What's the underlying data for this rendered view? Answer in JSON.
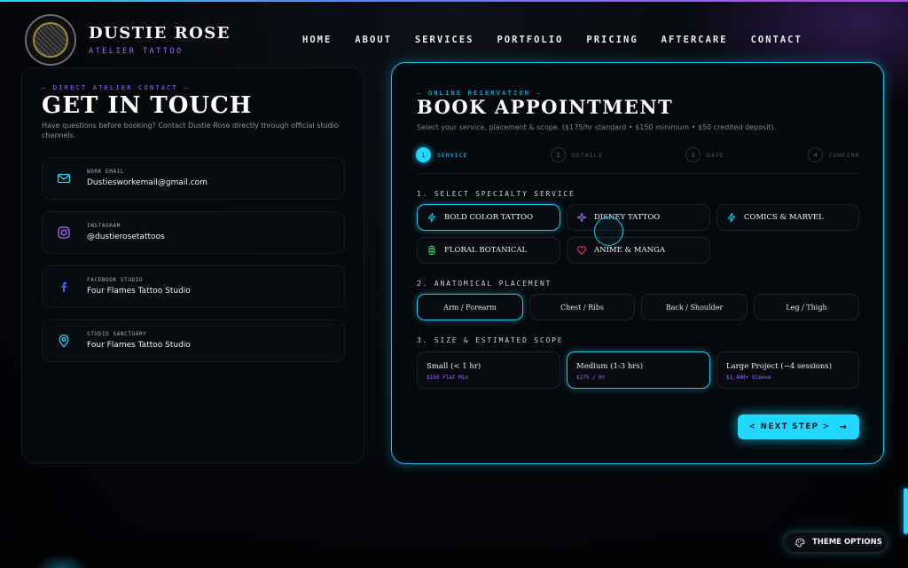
{
  "brand": {
    "name": "DUSTIE ROSE",
    "subtitle": "ATELIER TATTOO",
    "logo_text": "DUSTIE ROSE"
  },
  "nav": [
    "HOME",
    "ABOUT",
    "SERVICES",
    "PORTFOLIO",
    "PRICING",
    "AFTERCARE",
    "CONTACT"
  ],
  "contact": {
    "eyebrow": "— DIRECT ATELIER CONTACT —",
    "title": "GET IN TOUCH",
    "description": "Have questions before booking? Contact Dustie Rose directly through official studio channels.",
    "cards": [
      {
        "label": "WORK EMAIL",
        "value": "Dustiesworkemail@gmail.com",
        "icon": "mail-icon"
      },
      {
        "label": "INSTAGRAM",
        "value": "@dustierosetattoos",
        "icon": "instagram-icon"
      },
      {
        "label": "FACEBOOK STUDIO",
        "value": "Four Flames Tattoo Studio",
        "icon": "facebook-icon"
      },
      {
        "label": "STUDIO SANCTUARY",
        "value": "Four Flames Tattoo Studio",
        "icon": "map-pin-icon"
      }
    ]
  },
  "booking": {
    "eyebrow": "— ONLINE RESERVATION —",
    "title": "BOOK APPOINTMENT",
    "description": "Select your service, placement & scope. ($175/hr standard • $150 minimum • $50 credited deposit).",
    "steps": [
      {
        "num": "1",
        "label": "SERVICE",
        "active": true
      },
      {
        "num": "2",
        "label": "DETAILS",
        "active": false
      },
      {
        "num": "3",
        "label": "DATE",
        "active": false
      },
      {
        "num": "4",
        "label": "CONFIRM",
        "active": false
      }
    ],
    "section_service": "1. SELECT SPECIALTY SERVICE",
    "services": [
      {
        "label": "BOLD COLOR TATTOO",
        "icon": "lightning-icon",
        "selected": true
      },
      {
        "label": "DISNEY TATTOO",
        "icon": "sparkle-icon",
        "selected": false
      },
      {
        "label": "COMICS & MARVEL",
        "icon": "lightning-icon",
        "selected": false
      },
      {
        "label": "FLORAL BOTANICAL",
        "icon": "leaf-icon",
        "selected": false
      },
      {
        "label": "ANIME & MANGA",
        "icon": "heart-icon",
        "selected": false
      }
    ],
    "section_placement": "2. ANATOMICAL PLACEMENT",
    "placements": [
      {
        "label": "Arm / Forearm",
        "selected": true
      },
      {
        "label": "Chest / Ribs",
        "selected": false
      },
      {
        "label": "Back / Shoulder",
        "selected": false
      },
      {
        "label": "Leg / Thigh",
        "selected": false
      }
    ],
    "section_size": "3. SIZE & ESTIMATED SCOPE",
    "sizes": [
      {
        "label": "Small (< 1 hr)",
        "price": "$150 Flat Min",
        "selected": false
      },
      {
        "label": "Medium (1-3 hrs)",
        "price": "$175 / Hr",
        "selected": true
      },
      {
        "label": "Large Project (~4 sessions)",
        "price": "$1,400+ Sleeve",
        "selected": false
      }
    ],
    "next_label": "< NEXT STEP >",
    "next_arrow": "→"
  },
  "theme_button": "THEME OPTIONS",
  "colors": {
    "accent": "#1fd7ff",
    "purple": "#a16bff",
    "background": "#04060a"
  }
}
